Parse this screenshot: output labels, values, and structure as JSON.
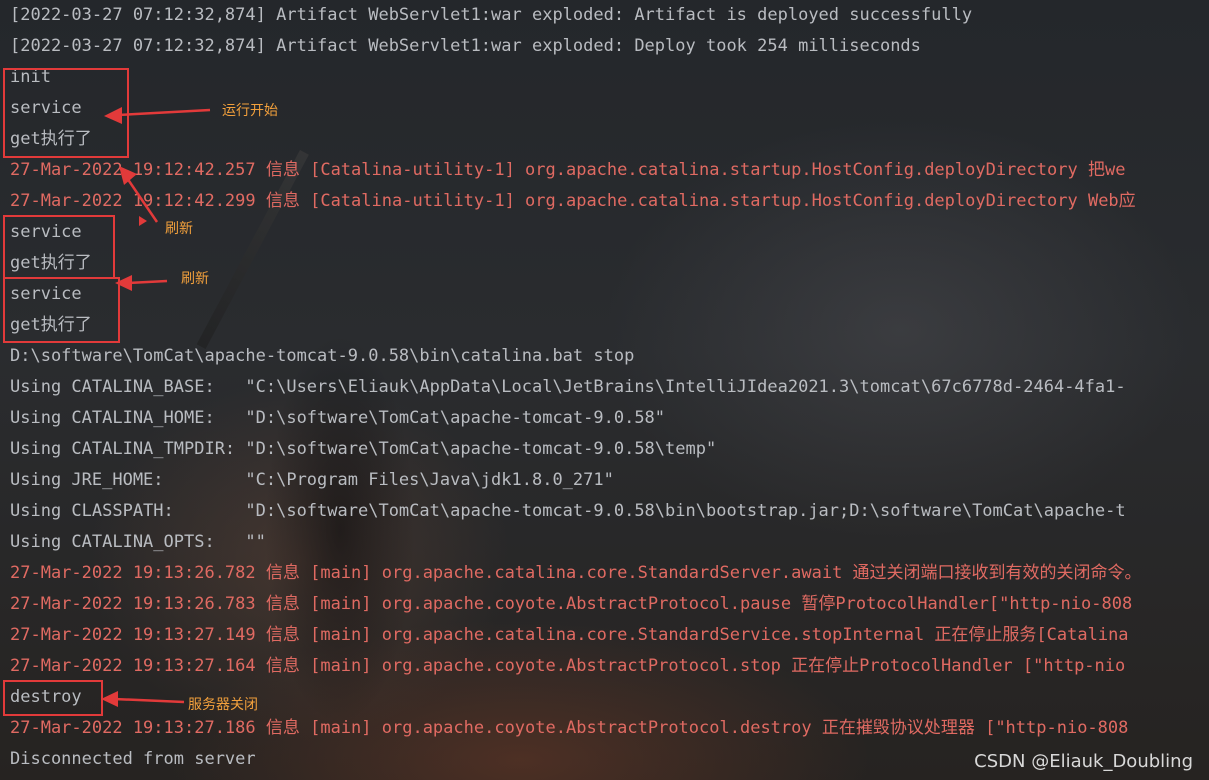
{
  "console": {
    "lines": [
      {
        "text": "[2022-03-27 07:12:32,874] Artifact WebServlet1:war exploded: Artifact is deployed successfully",
        "color": "gray"
      },
      {
        "text": "[2022-03-27 07:12:32,874] Artifact WebServlet1:war exploded: Deploy took 254 milliseconds",
        "color": "gray"
      },
      {
        "text": "init",
        "color": "gray"
      },
      {
        "text": "service",
        "color": "gray"
      },
      {
        "text": "get执行了",
        "color": "gray"
      },
      {
        "text": "27-Mar-2022 19:12:42.257 信息 [Catalina-utility-1] org.apache.catalina.startup.HostConfig.deployDirectory 把we",
        "color": "red"
      },
      {
        "text": "27-Mar-2022 19:12:42.299 信息 [Catalina-utility-1] org.apache.catalina.startup.HostConfig.deployDirectory Web应",
        "color": "red"
      },
      {
        "text": "service",
        "color": "gray"
      },
      {
        "text": "get执行了",
        "color": "gray"
      },
      {
        "text": "service",
        "color": "gray"
      },
      {
        "text": "get执行了",
        "color": "gray"
      },
      {
        "text": "D:\\software\\TomCat\\apache-tomcat-9.0.58\\bin\\catalina.bat stop",
        "color": "gray"
      },
      {
        "text": "Using CATALINA_BASE:   \"C:\\Users\\Eliauk\\AppData\\Local\\JetBrains\\IntelliJIdea2021.3\\tomcat\\67c6778d-2464-4fa1-",
        "color": "gray"
      },
      {
        "text": "Using CATALINA_HOME:   \"D:\\software\\TomCat\\apache-tomcat-9.0.58\"",
        "color": "gray"
      },
      {
        "text": "Using CATALINA_TMPDIR: \"D:\\software\\TomCat\\apache-tomcat-9.0.58\\temp\"",
        "color": "gray"
      },
      {
        "text": "Using JRE_HOME:        \"C:\\Program Files\\Java\\jdk1.8.0_271\"",
        "color": "gray"
      },
      {
        "text": "Using CLASSPATH:       \"D:\\software\\TomCat\\apache-tomcat-9.0.58\\bin\\bootstrap.jar;D:\\software\\TomCat\\apache-t",
        "color": "gray"
      },
      {
        "text": "Using CATALINA_OPTS:   \"\"",
        "color": "gray"
      },
      {
        "text": "27-Mar-2022 19:13:26.782 信息 [main] org.apache.catalina.core.StandardServer.await 通过关闭端口接收到有效的关闭命令。",
        "color": "red"
      },
      {
        "text": "27-Mar-2022 19:13:26.783 信息 [main] org.apache.coyote.AbstractProtocol.pause 暂停ProtocolHandler[\"http-nio-808",
        "color": "red"
      },
      {
        "text": "27-Mar-2022 19:13:27.149 信息 [main] org.apache.catalina.core.StandardService.stopInternal 正在停止服务[Catalina",
        "color": "red"
      },
      {
        "text": "27-Mar-2022 19:13:27.164 信息 [main] org.apache.coyote.AbstractProtocol.stop 正在停止ProtocolHandler [\"http-nio",
        "color": "red"
      },
      {
        "text": "destroy",
        "color": "gray"
      },
      {
        "text": "27-Mar-2022 19:13:27.186 信息 [main] org.apache.coyote.AbstractProtocol.destroy 正在摧毁协议处理器 [\"http-nio-808",
        "color": "red"
      },
      {
        "text": "Disconnected from server",
        "color": "gray"
      }
    ]
  },
  "annotations": {
    "run_start": "运行开始",
    "refresh_1": "刷新",
    "refresh_2": "刷新",
    "server_shutdown": "服务器关闭",
    "box_color": "#e23a3a",
    "note_color": "#f2a03c"
  },
  "watermark": "CSDN @Eliauk_Doubling",
  "colors": {
    "gray_text": "#b9bcc1",
    "red_text": "#e06a62"
  }
}
